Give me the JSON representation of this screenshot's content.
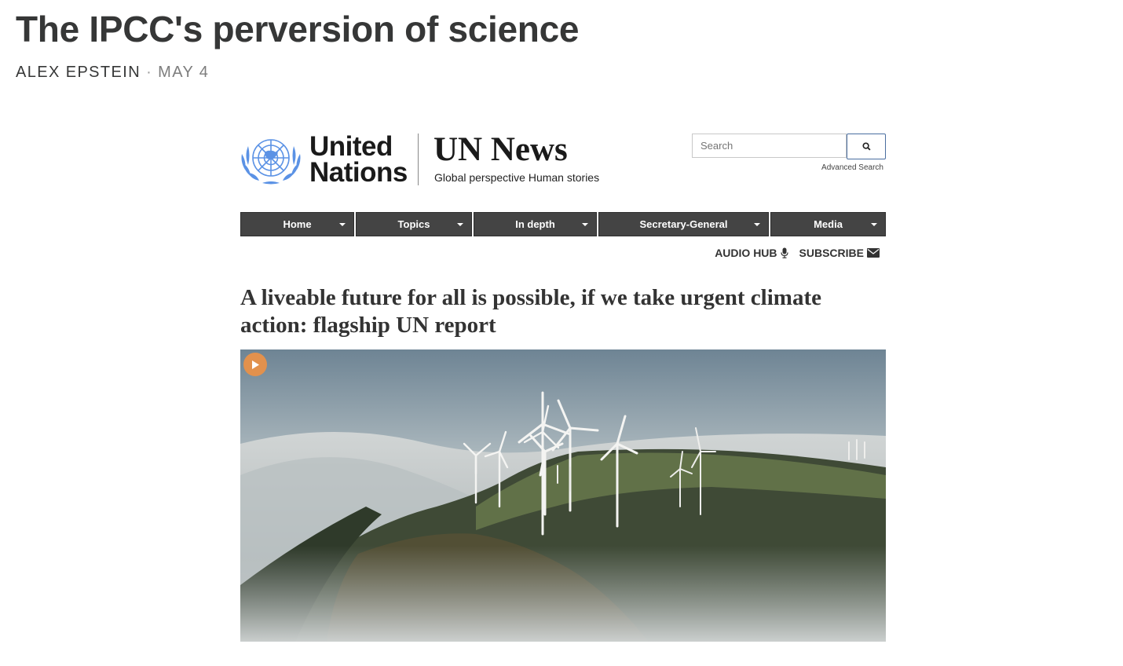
{
  "post": {
    "title": "The IPCC's perversion of science",
    "author": "ALEX EPSTEIN",
    "separator": "·",
    "date": "MAY 4"
  },
  "embed": {
    "header": {
      "logo_icon": "un-emblem-icon",
      "org_line1": "United",
      "org_line2": "Nations",
      "site_name": "UN News",
      "tagline": "Global perspective Human stories",
      "search_placeholder": "Search",
      "search_icon": "search-icon",
      "advanced_search": "Advanced Search"
    },
    "nav": [
      {
        "label": "Home"
      },
      {
        "label": "Topics"
      },
      {
        "label": "In depth"
      },
      {
        "label": "Secretary-General"
      },
      {
        "label": "Media"
      }
    ],
    "utility": {
      "audio_hub": "AUDIO HUB",
      "audio_icon": "microphone-icon",
      "subscribe": "SUBSCRIBE",
      "subscribe_icon": "envelope-icon"
    },
    "article": {
      "title": "A liveable future for all is possible, if we take urgent climate action: flagship UN report",
      "media_icon": "play-icon"
    }
  },
  "colors": {
    "nav_bg": "#444444",
    "un_blue": "#5b92e5",
    "play_orange": "#e2914d"
  }
}
